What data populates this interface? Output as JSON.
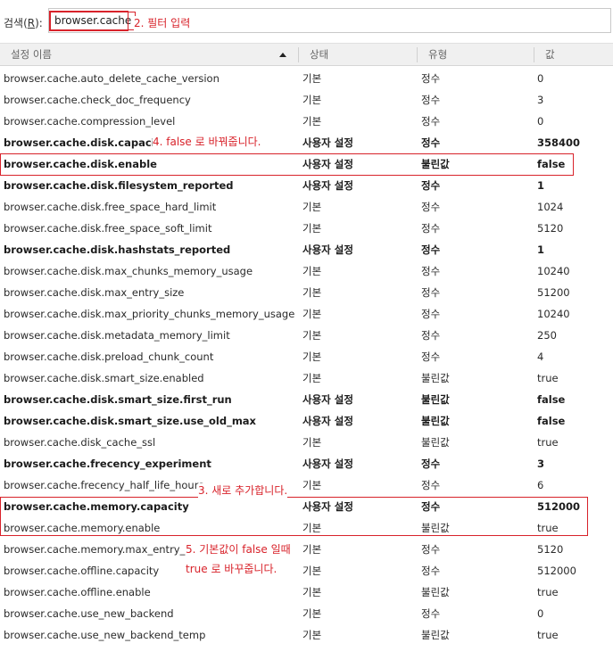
{
  "search": {
    "label_prefix": "검색(",
    "label_key": "R",
    "label_suffix": "):",
    "value": "browser.cache"
  },
  "columns": {
    "name": "설정 이름",
    "status": "상태",
    "type": "유형",
    "value": "값"
  },
  "rows": [
    {
      "name": "browser.cache.auto_delete_cache_version",
      "status": "기본",
      "type": "정수",
      "value": "0",
      "user": false
    },
    {
      "name": "browser.cache.check_doc_frequency",
      "status": "기본",
      "type": "정수",
      "value": "3",
      "user": false
    },
    {
      "name": "browser.cache.compression_level",
      "status": "기본",
      "type": "정수",
      "value": "0",
      "user": false
    },
    {
      "name": "browser.cache.disk.capacity",
      "status": "사용자 설정",
      "type": "정수",
      "value": "358400",
      "user": true
    },
    {
      "name": "browser.cache.disk.enable",
      "status": "사용자 설정",
      "type": "불린값",
      "value": "false",
      "user": true
    },
    {
      "name": "browser.cache.disk.filesystem_reported",
      "status": "사용자 설정",
      "type": "정수",
      "value": "1",
      "user": true
    },
    {
      "name": "browser.cache.disk.free_space_hard_limit",
      "status": "기본",
      "type": "정수",
      "value": "1024",
      "user": false
    },
    {
      "name": "browser.cache.disk.free_space_soft_limit",
      "status": "기본",
      "type": "정수",
      "value": "5120",
      "user": false
    },
    {
      "name": "browser.cache.disk.hashstats_reported",
      "status": "사용자 설정",
      "type": "정수",
      "value": "1",
      "user": true
    },
    {
      "name": "browser.cache.disk.max_chunks_memory_usage",
      "status": "기본",
      "type": "정수",
      "value": "10240",
      "user": false
    },
    {
      "name": "browser.cache.disk.max_entry_size",
      "status": "기본",
      "type": "정수",
      "value": "51200",
      "user": false
    },
    {
      "name": "browser.cache.disk.max_priority_chunks_memory_usage",
      "status": "기본",
      "type": "정수",
      "value": "10240",
      "user": false
    },
    {
      "name": "browser.cache.disk.metadata_memory_limit",
      "status": "기본",
      "type": "정수",
      "value": "250",
      "user": false
    },
    {
      "name": "browser.cache.disk.preload_chunk_count",
      "status": "기본",
      "type": "정수",
      "value": "4",
      "user": false
    },
    {
      "name": "browser.cache.disk.smart_size.enabled",
      "status": "기본",
      "type": "불린값",
      "value": "true",
      "user": false
    },
    {
      "name": "browser.cache.disk.smart_size.first_run",
      "status": "사용자 설정",
      "type": "불린값",
      "value": "false",
      "user": true
    },
    {
      "name": "browser.cache.disk.smart_size.use_old_max",
      "status": "사용자 설정",
      "type": "불린값",
      "value": "false",
      "user": true
    },
    {
      "name": "browser.cache.disk_cache_ssl",
      "status": "기본",
      "type": "불린값",
      "value": "true",
      "user": false
    },
    {
      "name": "browser.cache.frecency_experiment",
      "status": "사용자 설정",
      "type": "정수",
      "value": "3",
      "user": true
    },
    {
      "name": "browser.cache.frecency_half_life_hours",
      "status": "기본",
      "type": "정수",
      "value": "6",
      "user": false
    },
    {
      "name": "browser.cache.memory.capacity",
      "status": "사용자 설정",
      "type": "정수",
      "value": "512000",
      "user": true
    },
    {
      "name": "browser.cache.memory.enable",
      "status": "기본",
      "type": "불린값",
      "value": "true",
      "user": false
    },
    {
      "name": "browser.cache.memory.max_entry_size",
      "status": "기본",
      "type": "정수",
      "value": "5120",
      "user": false
    },
    {
      "name": "browser.cache.offline.capacity",
      "status": "기본",
      "type": "정수",
      "value": "512000",
      "user": false
    },
    {
      "name": "browser.cache.offline.enable",
      "status": "기본",
      "type": "불린값",
      "value": "true",
      "user": false
    },
    {
      "name": "browser.cache.use_new_backend",
      "status": "기본",
      "type": "정수",
      "value": "0",
      "user": false
    },
    {
      "name": "browser.cache.use_new_backend_temp",
      "status": "기본",
      "type": "불린값",
      "value": "true",
      "user": false
    }
  ],
  "annotations": {
    "note2": "2. 필터 입력",
    "note3": "3. 새로 추가합니다.",
    "note4": "4. false 로 바꿔줍니다.",
    "note5_line1": "5. 기본값이 false 일때",
    "note5_line2": "true 로 바꾸줍니다."
  },
  "colors": {
    "annotation": "#d8222a",
    "header_bg": "#f0f0f0"
  }
}
